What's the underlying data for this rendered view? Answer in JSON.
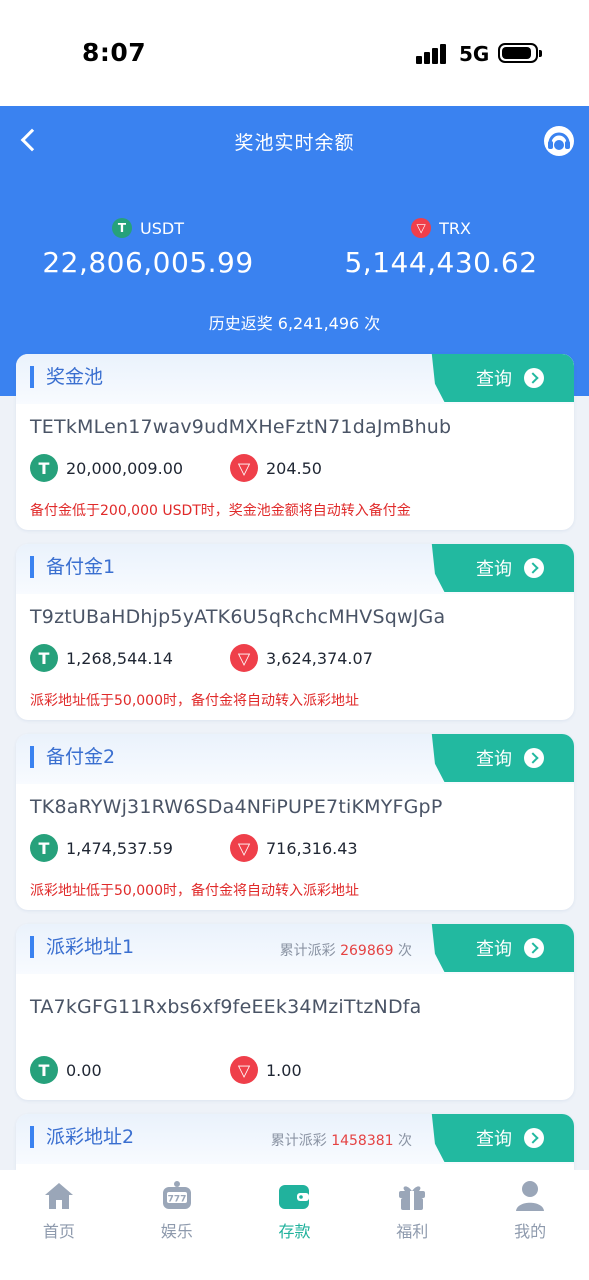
{
  "status": {
    "time": "8:07",
    "network": "5G"
  },
  "header": {
    "title": "奖池实时余额"
  },
  "totals": {
    "usdt_label": "USDT",
    "usdt_amount": "22,806,005.99",
    "trx_label": "TRX",
    "trx_amount": "5,144,430.62",
    "history": "历史返奖 6,241,496 次"
  },
  "cards": [
    {
      "title": "奖金池",
      "meta_prefix": "",
      "meta_count": "",
      "meta_suffix": "",
      "query": "查询",
      "address": "TETkMLen17wav9udMXHeFztN71daJmBhub",
      "usdt": "20,000,009.00",
      "trx": "204.50",
      "note": "备付金低于200,000 USDT时，奖金池金额将自动转入备付金"
    },
    {
      "title": "备付金1",
      "meta_prefix": "",
      "meta_count": "",
      "meta_suffix": "",
      "query": "查询",
      "address": "T9ztUBaHDhjp5yATK6U5qRchcMHVSqwJGa",
      "usdt": "1,268,544.14",
      "trx": "3,624,374.07",
      "note": "派彩地址低于50,000时，备付金将自动转入派彩地址"
    },
    {
      "title": "备付金2",
      "meta_prefix": "",
      "meta_count": "",
      "meta_suffix": "",
      "query": "查询",
      "address": "TK8aRYWj31RW6SDa4NFiPUPE7tiKMYFGpP",
      "usdt": "1,474,537.59",
      "trx": "716,316.43",
      "note": "派彩地址低于50,000时，备付金将自动转入派彩地址"
    },
    {
      "title": "派彩地址1",
      "meta_prefix": "累计派彩 ",
      "meta_count": "269869",
      "meta_suffix": " 次",
      "query": "查询",
      "address": "TA7kGFG11Rxbs6xf9feEEk34MziTtzNDfa",
      "usdt": "0.00",
      "trx": "1.00",
      "note": ""
    },
    {
      "title": "派彩地址2",
      "meta_prefix": "累计派彩 ",
      "meta_count": "1458381",
      "meta_suffix": " 次",
      "query": "查询",
      "address": "",
      "usdt": "",
      "trx": "",
      "note": ""
    }
  ],
  "tabs": [
    {
      "label": "首页",
      "icon": "home-icon"
    },
    {
      "label": "娱乐",
      "icon": "slot-machine-icon"
    },
    {
      "label": "存款",
      "icon": "wallet-icon"
    },
    {
      "label": "福利",
      "icon": "gift-icon"
    },
    {
      "label": "我的",
      "icon": "user-icon"
    }
  ],
  "colors": {
    "primary": "#3a82f0",
    "accent": "#22b9a0",
    "warning": "#e02a2a",
    "usdt": "#26a17b",
    "trx": "#ef3f4a"
  }
}
